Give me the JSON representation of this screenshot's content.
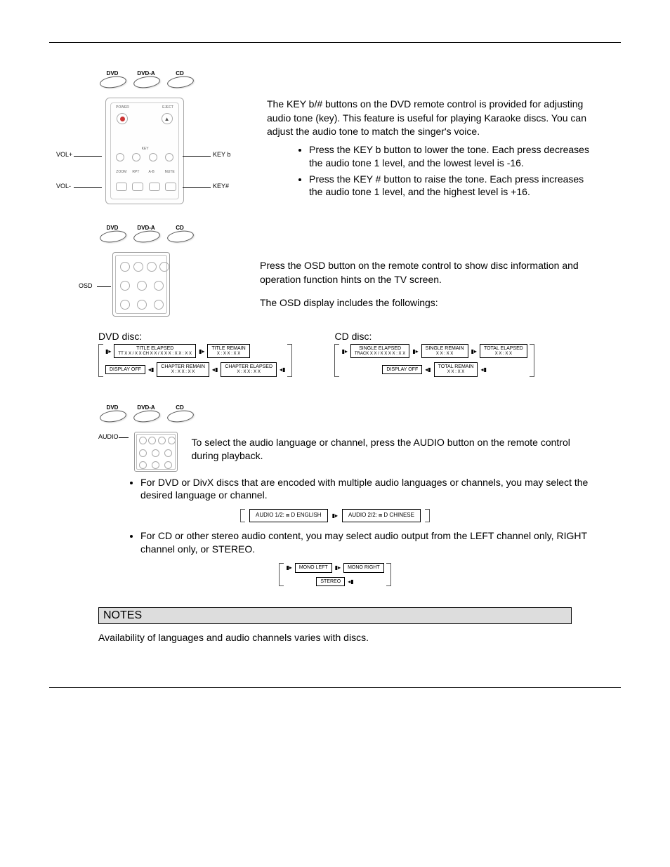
{
  "discs": {
    "dvd": "DVD",
    "dvda": "DVD-A",
    "cd": "CD"
  },
  "key_section": {
    "labels": {
      "keyb": "KEY b",
      "keysharp": "KEY#",
      "volplus": "VOL+",
      "volminus": "VOL-"
    },
    "remote_labels": {
      "power": "POWER",
      "eject": "EJECT",
      "zoom": "ZOOM",
      "rpt": "RPT",
      "ab": "A-B",
      "mute": "MUTE",
      "key": "KEY"
    },
    "intro": "The KEY b/# buttons on the DVD remote control is provided for adjusting audio tone (key).  This feature is useful for playing Karaoke discs.  You can adjust the audio tone to match the singer's voice.",
    "bullet1": "Press the KEY b button to lower the tone.  Each press decreases the audio tone 1 level, and the lowest level is -16.",
    "bullet2": "Press the KEY # button to raise the tone.  Each press increases the audio tone 1 level, and the highest level is +16."
  },
  "osd_section": {
    "label": "OSD",
    "p1": "Press the OSD button on the remote control to show disc information and operation function hints on the TV screen.",
    "p2": "The OSD display includes the followings:",
    "dvd_heading": "DVD disc:",
    "cd_heading": "CD disc:",
    "dvd_flow": {
      "title_elapsed": "TITLE ELAPSED",
      "title_elapsed_sub": "TT X  X / X  X  CH X  X / X  X   X : X X : X X",
      "title_remain": "TITLE REMAIN",
      "title_remain_sub": "X : X X : X X",
      "display_off": "DISPLAY OFF",
      "chapter_remain": "CHAPTER REMAIN",
      "chapter_remain_sub": "X : X X : X X",
      "chapter_elapsed": "CHAPTER ELAPSED",
      "chapter_elapsed_sub": "X : X X : X X"
    },
    "cd_flow": {
      "single_elapsed": "SINGLE ELAPSED",
      "single_elapsed_sub": "TRACK X  X / X  X   X X : X  X",
      "single_remain": "SINGLE REMAIN",
      "single_remain_sub": "X X : X X",
      "total_elapsed": "TOTAL ELAPSED",
      "total_elapsed_sub": "X X : X X",
      "display_off": "DISPLAY OFF",
      "total_remain": "TOTAL REMAIN",
      "total_remain_sub": "X X : X X"
    }
  },
  "audio_section": {
    "label": "AUDIO",
    "intro": "To select the audio language or channel, press the AUDIO button on the remote control during playback.",
    "bullet1": "For DVD or DivX discs that are encoded with multiple audio languages or channels, you may select the desired language or channel.",
    "bullet2": "For CD or other stereo audio content, you may select audio output from the LEFT channel only, RIGHT channel only, or STEREO.",
    "flow1": {
      "a": "AUDIO  1/2:  ⧈ D  ENGLISH",
      "b": "AUDIO  2/2:  ⧈ D  CHINESE"
    },
    "flow2": {
      "a": "MONO LEFT",
      "b": "MONO RIGHT",
      "c": "STEREO"
    }
  },
  "notes": {
    "heading": "NOTES",
    "text": "Availability of languages and audio channels varies with discs."
  }
}
